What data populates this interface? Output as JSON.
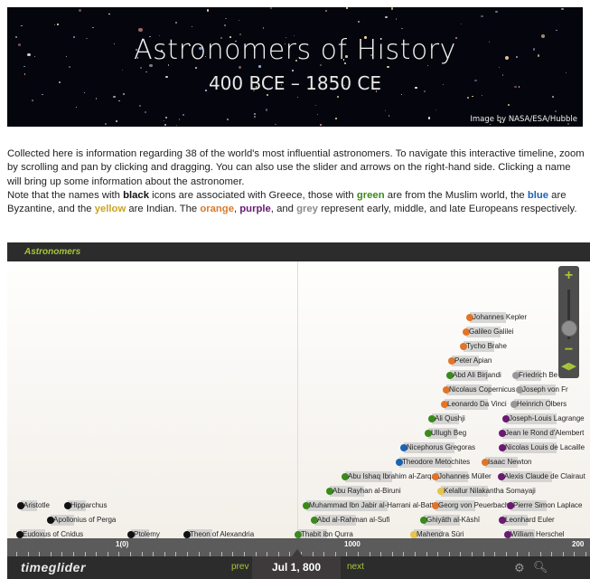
{
  "banner": {
    "title": "Astronomers of History",
    "subtitle": "400 BCE – 1850 CE",
    "credit": "Image by NASA/ESA/Hubble"
  },
  "intro": {
    "p1": "Collected here is information regarding 38 of the world's most influential astronomers.  To navigate this interactive timeline, zoom by scrolling and pan by clicking and dragging.  You can also use the slider and arrows on the right-hand side.  Clicking a name will bring up some information about the astronomer.",
    "p2_a": "Note that the names with ",
    "black": "black",
    "p2_b": " icons are associated with Greece, those with ",
    "green": "green",
    "p2_c": " are from the Muslim world, the ",
    "blue": "blue",
    "p2_d": " are Byzantine, and the ",
    "yellow": "yellow",
    "p2_e": " are Indian.  The ",
    "orange": "orange",
    "p2_f": ", ",
    "purple": "purple",
    "p2_g": ", and ",
    "grey": "grey",
    "p2_h": " represent early, middle, and late Europeans respectively."
  },
  "colors": {
    "greece": "#111111",
    "muslim": "#3a8a1c",
    "byzantine": "#1d63b4",
    "indian": "#e8c44a",
    "early_european": "#e0752a",
    "middle_european": "#6a1a72",
    "late_european": "#999999",
    "accent": "#a7c53a"
  },
  "timeline": {
    "header": "Astronomers",
    "events": [
      {
        "name": "Johannes Kepler",
        "group": "early_european"
      },
      {
        "name": "Galileo Galilei",
        "group": "early_european"
      },
      {
        "name": "Tycho Brahe",
        "group": "early_european"
      },
      {
        "name": "Peter Apian",
        "group": "early_european"
      },
      {
        "name": "Abd Ali Birjandi",
        "group": "muslim"
      },
      {
        "name": "Friedrich Be",
        "group": "late_european"
      },
      {
        "name": "Nicolaus Copernicus",
        "group": "early_european"
      },
      {
        "name": "Joseph von Fr",
        "group": "late_european"
      },
      {
        "name": "Leonardo Da Vinci",
        "group": "early_european"
      },
      {
        "name": "Heinrich Olbers",
        "group": "late_european"
      },
      {
        "name": "Ali Qushji",
        "group": "muslim"
      },
      {
        "name": "Joseph-Louis Lagrange",
        "group": "middle_european"
      },
      {
        "name": "Ullugh Beg",
        "group": "muslim"
      },
      {
        "name": "Jean le Rond d'Alembert",
        "group": "middle_european"
      },
      {
        "name": "Nicephorus Gregoras",
        "group": "byzantine"
      },
      {
        "name": "Nicolas Louis de Lacaille",
        "group": "middle_european"
      },
      {
        "name": "Theodore Metochites",
        "group": "byzantine"
      },
      {
        "name": "Isaac Newton",
        "group": "early_european"
      },
      {
        "name": "Abu Ishaq Ibrahim al-Zarqali",
        "group": "muslim"
      },
      {
        "name": "Johannes Müller",
        "group": "early_european"
      },
      {
        "name": "Alexis Claude de Clairaut",
        "group": "middle_european"
      },
      {
        "name": "Abu Rayhan al-Biruni",
        "group": "muslim"
      },
      {
        "name": "Kelallur Nilakantha Somayaji",
        "group": "indian"
      },
      {
        "name": "Aristotle",
        "group": "greece"
      },
      {
        "name": "Hipparchus",
        "group": "greece"
      },
      {
        "name": "Muhammad Ibn Jabir al-Harrani al-Battani",
        "group": "muslim"
      },
      {
        "name": "Georg von Peuerbach",
        "group": "early_european"
      },
      {
        "name": "Pierre Simon Laplace",
        "group": "middle_european"
      },
      {
        "name": "Apollonius of Perga",
        "group": "greece"
      },
      {
        "name": "Abd al-Rahman al-Sufi",
        "group": "muslim"
      },
      {
        "name": "Ghiyāth al-Kāshī",
        "group": "muslim"
      },
      {
        "name": "Leonhard Euler",
        "group": "middle_european"
      },
      {
        "name": "Eudoxus of Cnidus",
        "group": "greece"
      },
      {
        "name": "Ptolemy",
        "group": "greece"
      },
      {
        "name": "Theon of Alexandria",
        "group": "greece"
      },
      {
        "name": "Thabit ibn Qurra",
        "group": "muslim"
      },
      {
        "name": "Mahendra Sūri",
        "group": "indian"
      },
      {
        "name": "William Herschel",
        "group": "middle_european"
      }
    ],
    "ruler_labels": [
      "1(0)",
      "1000",
      "200"
    ],
    "prev": "prev",
    "next": "next",
    "focus_date": "Jul 1, 800",
    "logo": "timeglider",
    "zoom_in": "+",
    "zoom_out": "−",
    "pan": "◀▶"
  }
}
